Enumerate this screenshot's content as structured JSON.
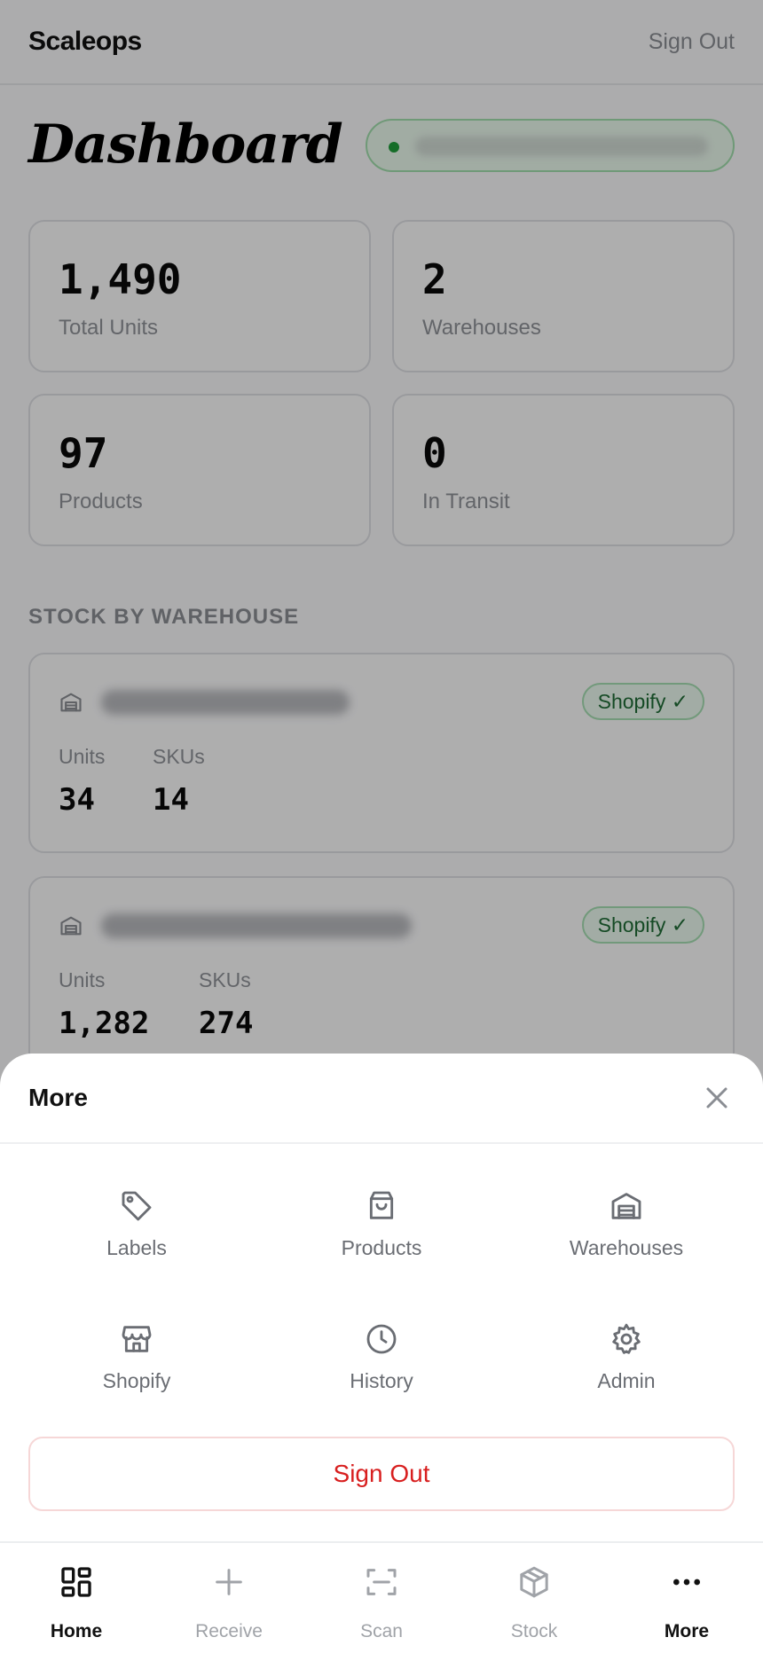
{
  "header": {
    "brand": "Scaleops",
    "sign_out": "Sign Out"
  },
  "page": {
    "title": "Dashboard"
  },
  "stats": [
    {
      "value": "1,490",
      "label": "Total Units"
    },
    {
      "value": "2",
      "label": "Warehouses"
    },
    {
      "value": "97",
      "label": "Products"
    },
    {
      "value": "0",
      "label": "In Transit"
    }
  ],
  "stock_section": {
    "heading": "STOCK BY WAREHOUSE",
    "warehouses": [
      {
        "badge": "Shopify ✓",
        "units_label": "Units",
        "units": "34",
        "skus_label": "SKUs",
        "skus": "14"
      },
      {
        "badge": "Shopify ✓",
        "units_label": "Units",
        "units": "1,282",
        "skus_label": "SKUs",
        "skus": "274"
      }
    ]
  },
  "sheet": {
    "title": "More",
    "items": [
      {
        "label": "Labels",
        "icon": "tag-icon"
      },
      {
        "label": "Products",
        "icon": "shopping-bag-icon"
      },
      {
        "label": "Warehouses",
        "icon": "warehouse-icon"
      },
      {
        "label": "Shopify",
        "icon": "store-icon"
      },
      {
        "label": "History",
        "icon": "clock-icon"
      },
      {
        "label": "Admin",
        "icon": "gear-icon"
      }
    ],
    "sign_out": "Sign Out"
  },
  "tabbar": {
    "tabs": [
      {
        "label": "Home",
        "icon": "grid-icon",
        "active": true
      },
      {
        "label": "Receive",
        "icon": "plus-icon",
        "active": false
      },
      {
        "label": "Scan",
        "icon": "scan-icon",
        "active": false
      },
      {
        "label": "Stock",
        "icon": "box-icon",
        "active": false
      },
      {
        "label": "More",
        "icon": "more-icon",
        "active": true
      }
    ]
  },
  "colors": {
    "accent_green": "#1f9d3a",
    "danger_red": "#d81f1f",
    "muted_text": "#8e9197"
  }
}
